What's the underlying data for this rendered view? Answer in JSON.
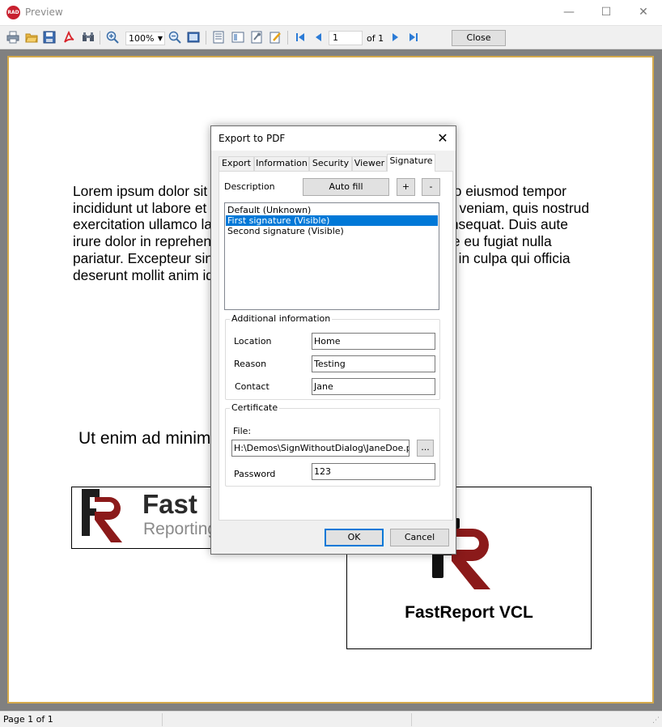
{
  "window": {
    "app_logo_text": "RAD",
    "title": "Preview",
    "minimize_glyph": "—",
    "maximize_glyph": "☐",
    "close_glyph": "✕"
  },
  "toolbar": {
    "icons": [
      "print-icon",
      "open-icon",
      "save-icon",
      "pdf-export-icon",
      "find-icon",
      "zoom-in-icon",
      "zoom-out-icon",
      "full-screen-icon",
      "outline-icon",
      "thumbnails-icon",
      "page-settings-icon",
      "edit-icon",
      "first-page-icon",
      "prev-page-icon",
      "next-page-icon",
      "last-page-icon"
    ],
    "zoom_value": "100%",
    "page_number": "1",
    "page_of": "of 1",
    "close_label": "Close"
  },
  "report": {
    "paragraph": "Lorem ipsum dolor sit amet, consectetur adipiscing elit, sed do eiusmod tempor incididunt ut labore et dolore magna aliqua. Ut enim ad minim veniam, quis nostrud exercitation ullamco laboris nisi ut aliquip ex ea commodo consequat. Duis aute irure dolor in reprehenderit in voluptate velit esse cillum dolore eu fugiat nulla pariatur. Excepteur sint occaecat cupidatat non proident, sunt in culpa qui officia deserunt mollit anim id est laborum.",
    "line2": "Ut enim ad minim veniam, quis nostrud irure dolor",
    "logo_left_title": "Fast",
    "logo_left_subtitle": "Reporting",
    "logo_right_caption": "FastReport VCL"
  },
  "status": {
    "page_text": "Page 1 of 1"
  },
  "dialog": {
    "title": "Export to PDF",
    "tabs": [
      "Export",
      "Information",
      "Security",
      "Viewer",
      "Signature"
    ],
    "active_tab": "Signature",
    "description_label": "Description",
    "auto_fill_label": "Auto fill",
    "add_label": "+",
    "remove_label": "-",
    "signatures": [
      "Default (Unknown)",
      "First signature (Visible)",
      "Second signature (Visible)"
    ],
    "selected_signature": "First signature (Visible)",
    "additional_info": {
      "title": "Additional information",
      "location_label": "Location",
      "location_value": "Home",
      "reason_label": "Reason",
      "reason_value": "Testing",
      "contact_label": "Contact",
      "contact_value": "Jane"
    },
    "certificate": {
      "title": "Certificate",
      "file_label": "File:",
      "file_value": "H:\\Demos\\SignWithoutDialog\\JaneDoe.pfx",
      "browse_label": "...",
      "password_label": "Password",
      "password_value": "123"
    },
    "ok_label": "OK",
    "cancel_label": "Cancel"
  },
  "colors": {
    "selection": "#0078d7",
    "page_border": "#d4a94b",
    "brand_red": "#8b1a1a"
  }
}
